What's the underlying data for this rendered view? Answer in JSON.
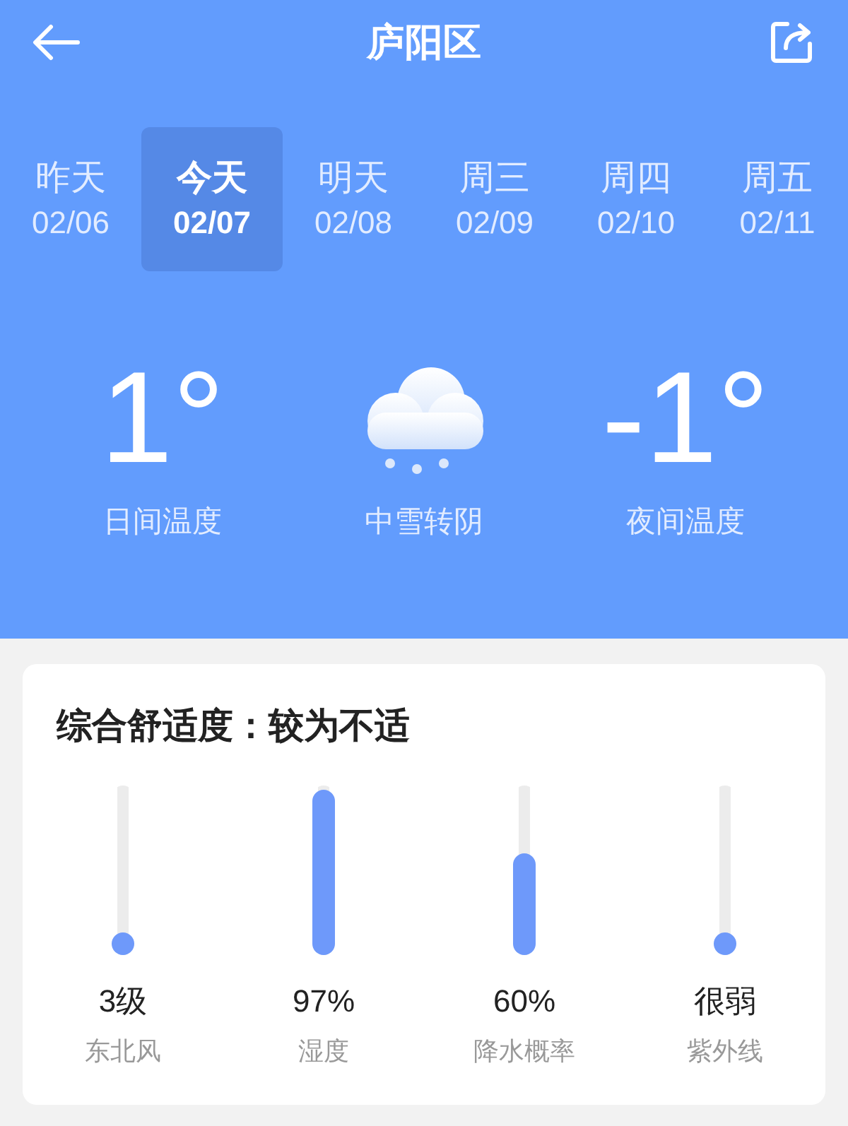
{
  "header": {
    "title": "庐阳区"
  },
  "days": [
    {
      "name": "昨天",
      "date": "02/06",
      "selected": false
    },
    {
      "name": "今天",
      "date": "02/07",
      "selected": true
    },
    {
      "name": "明天",
      "date": "02/08",
      "selected": false
    },
    {
      "name": "周三",
      "date": "02/09",
      "selected": false
    },
    {
      "name": "周四",
      "date": "02/10",
      "selected": false
    },
    {
      "name": "周五",
      "date": "02/11",
      "selected": false
    }
  ],
  "today": {
    "day_temp": "1°",
    "day_label": "日间温度",
    "condition": "中雪转阴",
    "night_temp": "-1°",
    "night_label": "夜间温度"
  },
  "comfort": {
    "title": "综合舒适度：较为不适",
    "metrics": [
      {
        "value": "3级",
        "label": "东北风",
        "level": 0.1
      },
      {
        "value": "97%",
        "label": "湿度",
        "level": 0.97
      },
      {
        "value": "60%",
        "label": "降水概率",
        "level": 0.6
      },
      {
        "value": "很弱",
        "label": "紫外线",
        "level": 0.05
      }
    ]
  }
}
